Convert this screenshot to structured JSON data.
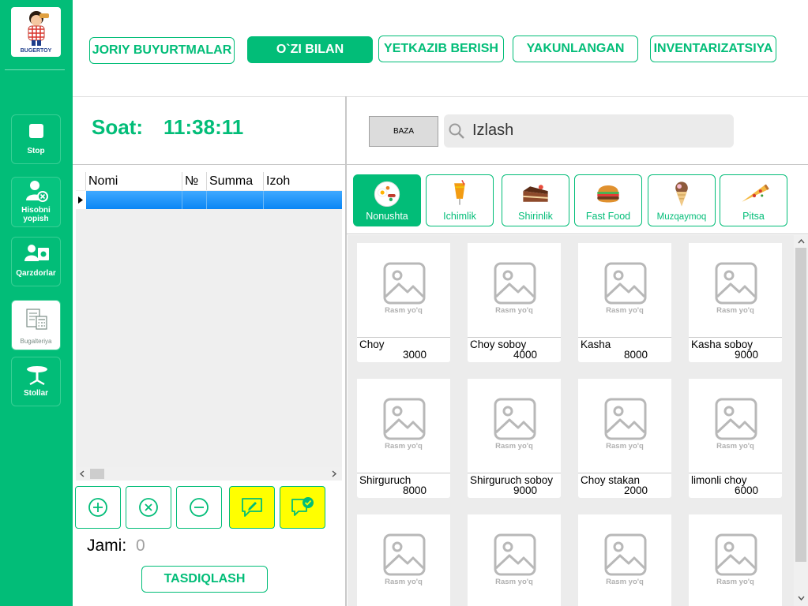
{
  "app": {
    "logo_text": "BUGERTOY"
  },
  "colors": {
    "brand": "#02bd78",
    "selection": "#0a86f5",
    "highlight": "#ffff00"
  },
  "sidebar": {
    "items": [
      {
        "label": "Stop",
        "icon": "stop-icon"
      },
      {
        "label": "Hisobni yopish",
        "icon": "close-bill-icon"
      },
      {
        "label": "Qarzdorlar",
        "icon": "debtors-icon"
      },
      {
        "label": "Bugalteriya",
        "icon": "accounting-icon"
      },
      {
        "label": "Stollar",
        "icon": "table-icon"
      }
    ]
  },
  "tabs": [
    {
      "label": "JORIY BUYURTMALAR",
      "active": false
    },
    {
      "label": "O`ZI BILAN",
      "active": true
    },
    {
      "label": "YETKAZIB BERISH",
      "active": false
    },
    {
      "label": "YAKUNLANGAN",
      "active": false
    },
    {
      "label": "INVENTARIZATSIYA",
      "active": false
    }
  ],
  "clock": {
    "label": "Soat:",
    "time": "11:38:11"
  },
  "baza_button": "BAZA",
  "search": {
    "placeholder": "Izlash"
  },
  "order_table": {
    "columns": [
      "Nomi",
      "№",
      "Summa",
      "Izoh"
    ],
    "rows": []
  },
  "actions": [
    "add-icon",
    "remove-icon",
    "minus-icon",
    "edit-comment-icon",
    "confirm-comment-icon"
  ],
  "total": {
    "label": "Jami:",
    "value": "0"
  },
  "confirm_button": "TASDIQLASH",
  "categories": [
    {
      "label": "Nonushta",
      "icon": "breakfast-icon",
      "active": true
    },
    {
      "label": "Ichimlik",
      "icon": "drink-icon",
      "active": false
    },
    {
      "label": "Shirinlik",
      "icon": "cake-icon",
      "active": false
    },
    {
      "label": "Fast Food",
      "icon": "burger-icon",
      "active": false
    },
    {
      "label": "Muzqaymoq",
      "icon": "ice-cream-icon",
      "active": false
    },
    {
      "label": "Pitsa",
      "icon": "pizza-icon",
      "active": false
    }
  ],
  "no_image_label": "Rasm yo'q",
  "products": [
    {
      "name": "Choy",
      "price": "3000"
    },
    {
      "name": "Choy soboy",
      "price": "4000"
    },
    {
      "name": "Kasha",
      "price": "8000"
    },
    {
      "name": "Kasha soboy",
      "price": "9000"
    },
    {
      "name": "Shirguruch",
      "price": "8000"
    },
    {
      "name": "Shirguruch soboy",
      "price": "9000"
    },
    {
      "name": "Choy stakan",
      "price": "2000"
    },
    {
      "name": "limonli choy",
      "price": "6000"
    },
    {
      "name": "",
      "price": ""
    },
    {
      "name": "",
      "price": ""
    },
    {
      "name": "",
      "price": ""
    },
    {
      "name": "",
      "price": ""
    }
  ]
}
